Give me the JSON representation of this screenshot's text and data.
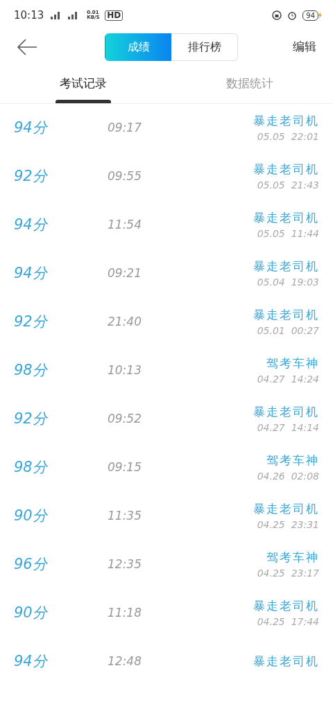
{
  "status_bar": {
    "time": "10:13",
    "net_speed": "0.01 KB/S",
    "hd": "HD",
    "battery": "94"
  },
  "header": {
    "segments": [
      {
        "label": "成绩",
        "selected": true
      },
      {
        "label": "排行榜",
        "selected": false
      }
    ],
    "edit": "编辑"
  },
  "tabs": [
    {
      "label": "考试记录",
      "selected": true
    },
    {
      "label": "数据统计",
      "selected": false
    }
  ],
  "records": [
    {
      "score": "94分",
      "duration": "09:17",
      "name": "暴走老司机",
      "date": "05.05  22:01"
    },
    {
      "score": "92分",
      "duration": "09:55",
      "name": "暴走老司机",
      "date": "05.05  21:43"
    },
    {
      "score": "94分",
      "duration": "11:54",
      "name": "暴走老司机",
      "date": "05.05  11:44"
    },
    {
      "score": "94分",
      "duration": "09:21",
      "name": "暴走老司机",
      "date": "05.04  19:03"
    },
    {
      "score": "92分",
      "duration": "21:40",
      "name": "暴走老司机",
      "date": "05.01  00:27"
    },
    {
      "score": "98分",
      "duration": "10:13",
      "name": "驾考车神",
      "date": "04.27  14:24"
    },
    {
      "score": "92分",
      "duration": "09:52",
      "name": "暴走老司机",
      "date": "04.27  14:14"
    },
    {
      "score": "98分",
      "duration": "09:15",
      "name": "驾考车神",
      "date": "04.26  02:08"
    },
    {
      "score": "90分",
      "duration": "11:35",
      "name": "暴走老司机",
      "date": "04.25  23:31"
    },
    {
      "score": "96分",
      "duration": "12:35",
      "name": "驾考车神",
      "date": "04.25  23:17"
    },
    {
      "score": "90分",
      "duration": "11:18",
      "name": "暴走老司机",
      "date": "04.25  17:44"
    },
    {
      "score": "94分",
      "duration": "12:48",
      "name": "暴走老司机"
    }
  ]
}
